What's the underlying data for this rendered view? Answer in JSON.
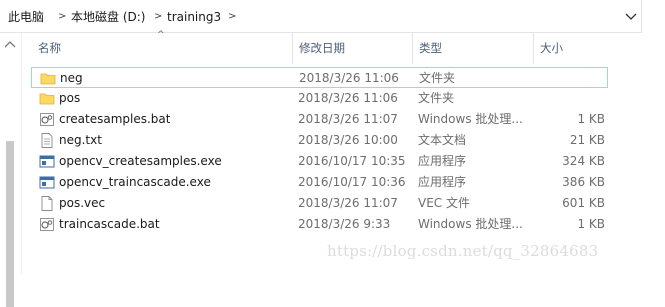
{
  "address": {
    "crumbs": [
      "此电脑",
      "本地磁盘 (D:)",
      "training3"
    ],
    "separator": ">"
  },
  "columns": {
    "name": "名称",
    "date": "修改日期",
    "type": "类型",
    "size": "大小"
  },
  "files": [
    {
      "name": "neg",
      "date": "2018/3/26 11:06",
      "type": "文件夹",
      "size": "",
      "icon": "folder-icon",
      "selected": true
    },
    {
      "name": "pos",
      "date": "2018/3/26 11:06",
      "type": "文件夹",
      "size": "",
      "icon": "folder-icon",
      "selected": false
    },
    {
      "name": "createsamples.bat",
      "date": "2018/3/26 11:07",
      "type": "Windows 批处理...",
      "size": "1 KB",
      "icon": "batch-file-icon",
      "selected": false
    },
    {
      "name": "neg.txt",
      "date": "2018/3/26 10:00",
      "type": "文本文档",
      "size": "21 KB",
      "icon": "text-file-icon",
      "selected": false
    },
    {
      "name": "opencv_createsamples.exe",
      "date": "2016/10/17 10:35",
      "type": "应用程序",
      "size": "324 KB",
      "icon": "application-icon",
      "selected": false
    },
    {
      "name": "opencv_traincascade.exe",
      "date": "2016/10/17 10:36",
      "type": "应用程序",
      "size": "386 KB",
      "icon": "application-icon",
      "selected": false
    },
    {
      "name": "pos.vec",
      "date": "2018/3/26 11:07",
      "type": "VEC 文件",
      "size": "601 KB",
      "icon": "generic-file-icon",
      "selected": false
    },
    {
      "name": "traincascade.bat",
      "date": "2018/3/26 9:33",
      "type": "Windows 批处理...",
      "size": "1 KB",
      "icon": "batch-file-icon",
      "selected": false
    }
  ],
  "watermark": "https://blog.csdn.net/qq_32864683",
  "colors": {
    "folder": "#ffd862",
    "selection_border": "#99d1ff",
    "header_text": "#4c607a",
    "secondary_text": "#6d6d6d"
  }
}
